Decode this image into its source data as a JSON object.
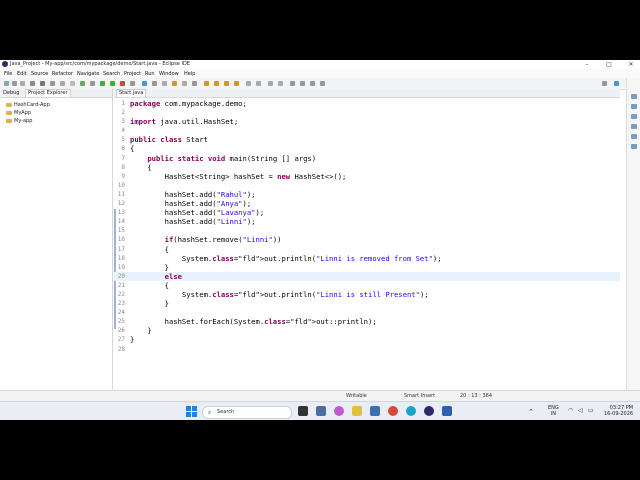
{
  "window": {
    "title": "Java_Project - My-app/src/com/mypackage/demo/Start.java - Eclipse IDE",
    "controls": {
      "minimize": "–",
      "maximize": "□",
      "close": "✕"
    }
  },
  "menu": [
    "File",
    "Edit",
    "Source",
    "Refactor",
    "Navigate",
    "Search",
    "Project",
    "Run",
    "Window",
    "Help"
  ],
  "left_panel": {
    "tabs": [
      "Debug",
      "Project Explorer"
    ],
    "tree": [
      {
        "label": "HashCard-App"
      },
      {
        "label": "MyApp"
      },
      {
        "label": "My-app"
      }
    ]
  },
  "editor": {
    "tab_label": "Start.java",
    "lines": [
      {
        "n": "1",
        "text": "package com.mypackage.demo;"
      },
      {
        "n": "2",
        "text": ""
      },
      {
        "n": "3",
        "text": "import java.util.HashSet;"
      },
      {
        "n": "4",
        "text": ""
      },
      {
        "n": "5",
        "text": "public class Start"
      },
      {
        "n": "6",
        "text": "{"
      },
      {
        "n": "7",
        "text": "    public static void main(String [] args)"
      },
      {
        "n": "8",
        "text": "    {"
      },
      {
        "n": "9",
        "text": "        HashSet<String> hashSet = new HashSet<>();"
      },
      {
        "n": "10",
        "text": ""
      },
      {
        "n": "11",
        "text": "        hashSet.add(\"Rahul\");"
      },
      {
        "n": "12",
        "text": "        hashSet.add(\"Anya\");"
      },
      {
        "n": "13",
        "text": "        hashSet.add(\"Lavanya\");"
      },
      {
        "n": "14",
        "text": "        hashSet.add(\"Linni\");"
      },
      {
        "n": "15",
        "text": ""
      },
      {
        "n": "16",
        "text": "        if(hashSet.remove(\"Linni\"))"
      },
      {
        "n": "17",
        "text": "        {"
      },
      {
        "n": "18",
        "text": "            System.out.println(\"Linni is removed from Set\");"
      },
      {
        "n": "19",
        "text": "        }"
      },
      {
        "n": "20",
        "text": "        else"
      },
      {
        "n": "21",
        "text": "        {"
      },
      {
        "n": "22",
        "text": "            System.out.println(\"Linni is still Present\");"
      },
      {
        "n": "23",
        "text": "        }"
      },
      {
        "n": "24",
        "text": ""
      },
      {
        "n": "25",
        "text": "        hashSet.forEach(System.out::println);"
      },
      {
        "n": "26",
        "text": "    }"
      },
      {
        "n": "27",
        "text": "}"
      },
      {
        "n": "28",
        "text": ""
      }
    ],
    "current_line": "20"
  },
  "status": {
    "mode": "Writable",
    "insert": "Smart Insert",
    "position": "20 : 13 : 384"
  },
  "taskbar": {
    "search_label": "Search",
    "lang": "ENG",
    "region": "IN",
    "time": "03:27 PM",
    "date": "16-09-2026"
  },
  "colors": {
    "keyword": "#7f0055",
    "string": "#2a00ff",
    "field": "#0000c0",
    "current_line": "#e8f2fe"
  }
}
